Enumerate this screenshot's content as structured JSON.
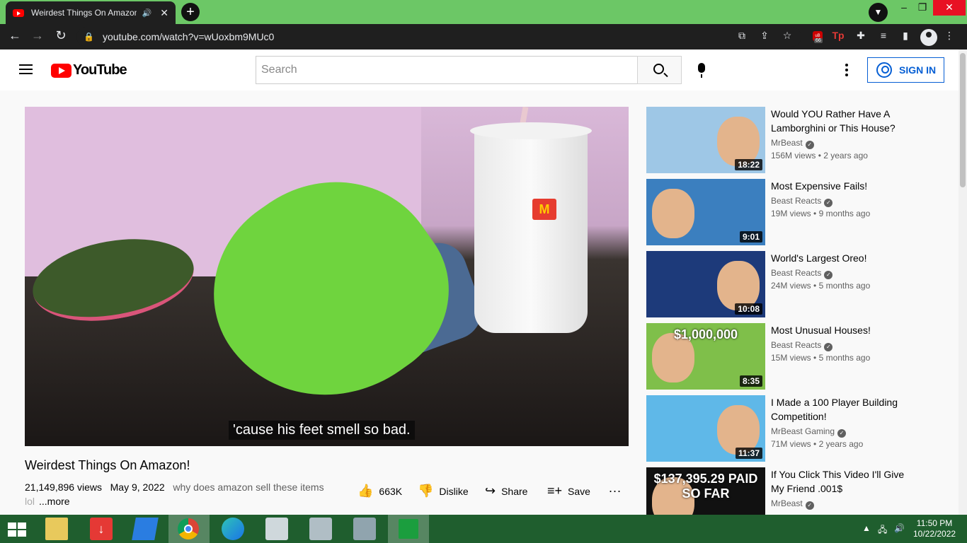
{
  "browser": {
    "tab_title": "Weirdest Things On Amazon",
    "tab_close": "✕",
    "new_tab": "+",
    "url": "youtube.com/watch?v=wUoxbm9MUc0",
    "ext_badge_count": "66",
    "window_buttons": {
      "minimize": "–",
      "restore": "❐",
      "close": "✕"
    }
  },
  "youtube": {
    "logo_text": "YouTube",
    "search_placeholder": "Search",
    "sign_in": "SIGN IN"
  },
  "player": {
    "caption": "'cause his feet smell so bad."
  },
  "video": {
    "title": "Weirdest Things On Amazon!",
    "views": "21,149,896 views",
    "date": "May 9, 2022",
    "description_preview": "why does amazon sell these items",
    "description_second_line": "lol",
    "more": "...more",
    "likes": "663K",
    "dislike": "Dislike",
    "share": "Share",
    "save": "Save",
    "more_actions": "..."
  },
  "recommendations": [
    {
      "title": "Would YOU Rather Have A Lamborghini or This House?",
      "channel": "MrBeast",
      "views": "156M views",
      "age": "2 years ago",
      "duration": "18:22",
      "thumb_color": "#9ec7e6",
      "overlay": ""
    },
    {
      "title": "Most Expensive Fails!",
      "channel": "Beast Reacts",
      "views": "19M views",
      "age": "9 months ago",
      "duration": "9:01",
      "thumb_color": "#3b7fbf",
      "overlay": ""
    },
    {
      "title": "World's Largest Oreo!",
      "channel": "Beast Reacts",
      "views": "24M views",
      "age": "5 months ago",
      "duration": "10:08",
      "thumb_color": "#1d3a7a",
      "overlay": ""
    },
    {
      "title": "Most Unusual Houses!",
      "channel": "Beast Reacts",
      "views": "15M views",
      "age": "5 months ago",
      "duration": "8:35",
      "thumb_color": "#7fbf4a",
      "overlay": "$1,000,000"
    },
    {
      "title": "I Made a 100 Player Building Competition!",
      "channel": "MrBeast Gaming",
      "views": "71M views",
      "age": "2 years ago",
      "duration": "11:37",
      "thumb_color": "#5fb8e8",
      "overlay": ""
    },
    {
      "title": "If You Click This Video I'll Give My Friend .001$",
      "channel": "MrBeast",
      "views": "",
      "age": "",
      "duration": "",
      "thumb_color": "#111111",
      "overlay": "$137,395.29 PAID SO FAR"
    }
  ],
  "taskbar": {
    "time": "11:50 PM",
    "date": "10/22/2022"
  },
  "colors": {
    "browser_frame": "#6cc766",
    "youtube_red": "#ff0000",
    "link_blue": "#065fd4",
    "taskbar": "#1f5e2e"
  }
}
